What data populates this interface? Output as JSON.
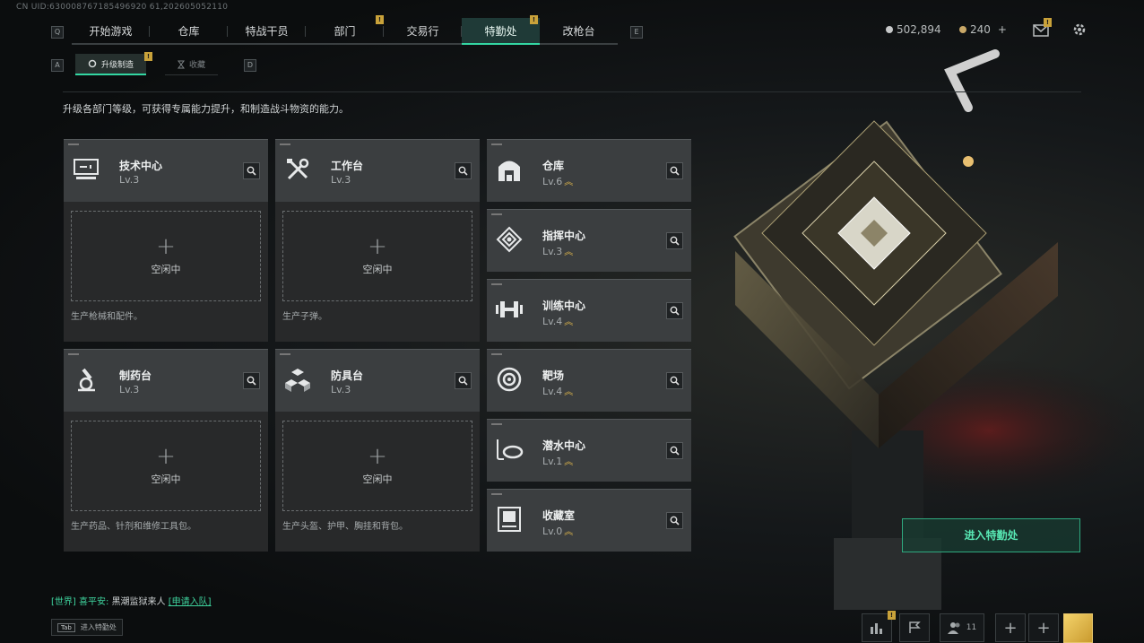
{
  "uid": "CN UID:630008767185496920 61,202605052110",
  "key_hints": {
    "left_tab": "Q",
    "right_tab": "E",
    "sub_left": "A",
    "sub_right": "D"
  },
  "topnav": {
    "tabs": [
      {
        "label": "开始游戏"
      },
      {
        "label": "仓库"
      },
      {
        "label": "特战干员"
      },
      {
        "label": "部门",
        "badge": "!"
      },
      {
        "label": "交易行"
      },
      {
        "label": "特勤处",
        "badge": "!",
        "active": true
      },
      {
        "label": "改枪台"
      }
    ]
  },
  "currency": {
    "silver": "502,894",
    "gold": "240",
    "gold_add": "+"
  },
  "subtabs": {
    "active": "升级制造",
    "active_badge": "!",
    "inactive": "收藏"
  },
  "description": "升级各部门等级，可获得专属能力提升，和制造战斗物资的能力。",
  "slot_idle": "空闲中",
  "workstations": [
    {
      "name": "技术中心",
      "level": "Lv.3",
      "icon": "computer-icon",
      "note": "生产枪械和配件。"
    },
    {
      "name": "工作台",
      "level": "Lv.3",
      "icon": "tools-icon",
      "note": "生产子弹。"
    },
    {
      "name": "制药台",
      "level": "Lv.3",
      "icon": "microscope-icon",
      "note": "生产药品、针剂和维修工具包。"
    },
    {
      "name": "防具台",
      "level": "Lv.3",
      "icon": "cubes-icon",
      "note": "生产头盔、护甲、胸挂和背包。"
    }
  ],
  "departments": [
    {
      "name": "仓库",
      "level": "Lv.6",
      "icon": "warehouse-icon",
      "upgradable": true
    },
    {
      "name": "指挥中心",
      "level": "Lv.3",
      "icon": "command-icon",
      "upgradable": true
    },
    {
      "name": "训练中心",
      "level": "Lv.4",
      "icon": "dumbbell-icon",
      "upgradable": true
    },
    {
      "name": "靶场",
      "level": "Lv.4",
      "icon": "target-icon",
      "upgradable": true
    },
    {
      "name": "潜水中心",
      "level": "Lv.1",
      "icon": "diving-mask-icon",
      "upgradable": true
    },
    {
      "name": "收藏室",
      "level": "Lv.0",
      "icon": "collection-icon",
      "upgradable": true
    }
  ],
  "enter_button": "进入特勤处",
  "chat": {
    "channel": "[世界]",
    "sender": "喜平安:",
    "message": "黑潮监狱来人",
    "link": "[申请入队]"
  },
  "tab_hint": {
    "key": "Tab",
    "label": "进入特勤处"
  },
  "bottom": {
    "friends_count": "11",
    "stats_badge": "!",
    "add": "+"
  },
  "colors": {
    "accent": "#33d6a2",
    "badge": "#c9a23a",
    "panel": "#3b3e40"
  }
}
